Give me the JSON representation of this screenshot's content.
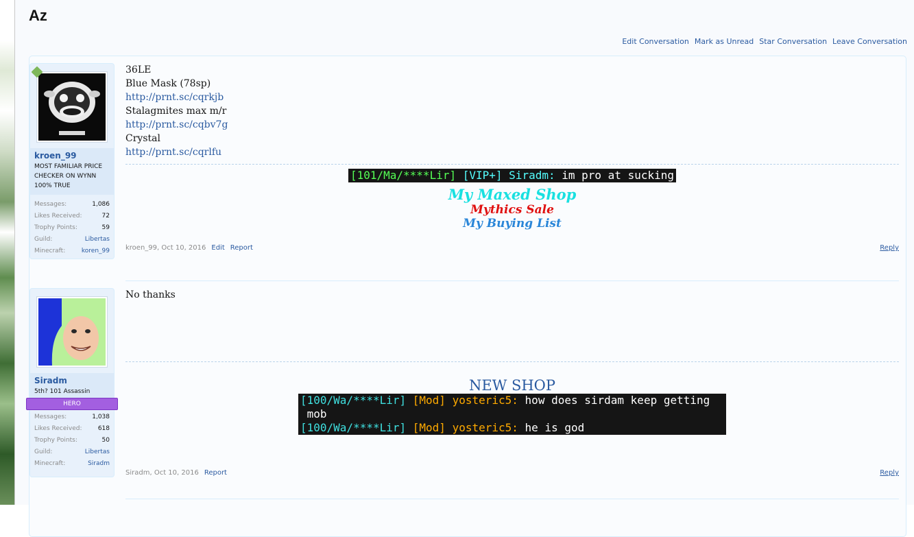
{
  "conversation": {
    "title": "Az",
    "links": [
      "Edit Conversation",
      "Mark as Unread",
      "Star Conversation",
      "Leave Conversation"
    ]
  },
  "posts": [
    {
      "user": {
        "name": "kroen_99",
        "title_lines": [
          "MOST FAMILIAR PRICE",
          "CHECKER ON WYNN",
          "100% TRUE"
        ],
        "stats": [
          {
            "label": "Messages:",
            "value": "1,086"
          },
          {
            "label": "Likes Received:",
            "value": "72"
          },
          {
            "label": "Trophy Points:",
            "value": "59"
          },
          {
            "label": "Guild:",
            "value": "Libertas"
          },
          {
            "label": "Minecraft:",
            "value": "koren_99"
          }
        ]
      },
      "message_lines": [
        "36LE",
        "Blue Mask (78sp)",
        "http://prnt.sc/cqrkjb",
        "Stalagmites max m/r",
        "http://prnt.sc/cqbv7g",
        "Crystal",
        "http://prnt.sc/cqrlfu"
      ],
      "signature": {
        "chat": {
          "tag": "[101/Ma/****Lir]",
          "rank": "[VIP+]",
          "player": "Siradm:",
          "text": "im pro at sucking"
        },
        "links": [
          "My Maxed Shop",
          "Mythics Sale",
          "My Buying List"
        ]
      },
      "meta": {
        "author": "kroen_99",
        "date": "Oct 10, 2016",
        "actions": [
          "Edit",
          "Report"
        ],
        "reply": "Reply"
      }
    },
    {
      "user": {
        "name": "Siradm",
        "title_lines": [
          "5th? 101 Assassin"
        ],
        "badge": "HERO",
        "stats": [
          {
            "label": "Messages:",
            "value": "1,038"
          },
          {
            "label": "Likes Received:",
            "value": "618"
          },
          {
            "label": "Trophy Points:",
            "value": "50"
          },
          {
            "label": "Guild:",
            "value": "Libertas"
          },
          {
            "label": "Minecraft:",
            "value": "Siradm"
          }
        ]
      },
      "message_lines": [
        "No thanks"
      ],
      "signature": {
        "heading": "NEW SHOP",
        "chat": [
          {
            "tag": "[100/Wa/****Lir]",
            "rank": "[Mod]",
            "player": "yosteric5:",
            "text": "how does sirdam keep getting",
            "cont": " mob"
          },
          {
            "tag": "[100/Wa/****Lir]",
            "rank": "[Mod]",
            "player": "yosteric5:",
            "text": "he is god"
          }
        ]
      },
      "meta": {
        "author": "Siradm",
        "date": "Oct 10, 2016",
        "actions": [
          "Report"
        ],
        "reply": "Reply"
      }
    }
  ],
  "colors": {
    "link": "#2a5aa0",
    "hero_badge": "#a35fe0",
    "border": "#d7edfc"
  }
}
